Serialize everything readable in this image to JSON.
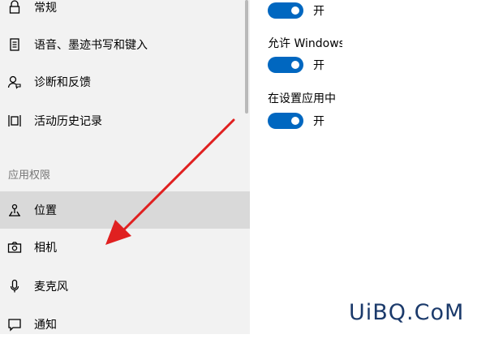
{
  "sidebar": {
    "items_top": [
      {
        "label": "常规",
        "icon": "lock-icon"
      },
      {
        "label": "语音、墨迹书写和键入",
        "icon": "notepad-icon"
      },
      {
        "label": "诊断和反馈",
        "icon": "feedback-icon"
      },
      {
        "label": "活动历史记录",
        "icon": "timeline-icon"
      }
    ],
    "section_title": "应用权限",
    "items_perm": [
      {
        "label": "位置",
        "icon": "location-icon",
        "selected": true
      },
      {
        "label": "相机",
        "icon": "camera-icon"
      },
      {
        "label": "麦克风",
        "icon": "microphone-icon"
      },
      {
        "label": "通知",
        "icon": "notification-icon"
      }
    ]
  },
  "main": {
    "toggles": [
      {
        "label": "",
        "state": "开"
      },
      {
        "label": "允许 Windows",
        "state": "开"
      },
      {
        "label": "在设置应用中",
        "state": "开"
      }
    ]
  },
  "watermark": "UiBQ.CoM",
  "colors": {
    "accent": "#0067c0",
    "arrow": "#e02020",
    "sidebar_bg": "#f2f2f2",
    "selected_bg": "#d9d9d9"
  }
}
